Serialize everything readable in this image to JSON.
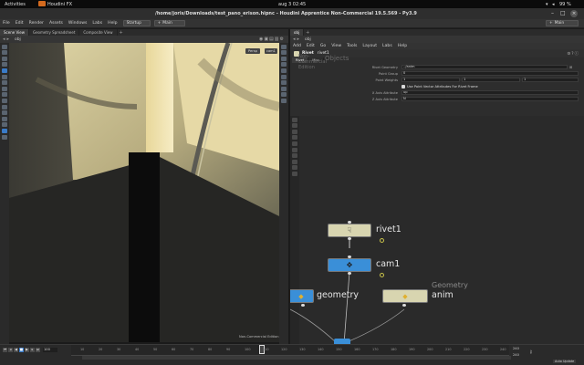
{
  "topbar": {
    "activities": "Activities",
    "app_name": "Houdini FX",
    "clock": "aug 3  02:45",
    "battery": "99 %"
  },
  "titlebar": {
    "title": "/home/joris/Downloads/test_pano_erison.hipnc - Houdini Apprentice Non-Commercial 19.5.569 - Py3.9"
  },
  "menubar": {
    "items": [
      "File",
      "Edit",
      "Render",
      "Assets",
      "Windows",
      "Labs",
      "Help"
    ],
    "desktop_selector": "Startup",
    "shelf_selector": "Main",
    "right_selector": "Main"
  },
  "left_pane": {
    "tabs": [
      "Scene View",
      "Geometry Spreadsheet",
      "Composite View"
    ],
    "path": "obj",
    "viewport_menus": [
      "Persp",
      "cam1"
    ],
    "watermark": "Non-Commercial Edition"
  },
  "right_pane": {
    "tabs": [
      "obj"
    ],
    "path": "obj",
    "menu_items": [
      "Add",
      "Edit",
      "Go",
      "View",
      "Tools",
      "Layout",
      "Labs",
      "Help"
    ],
    "node_type": "Rivet",
    "node_name": "rivet1",
    "param_tabs": [
      "Rivet",
      "Misc"
    ],
    "params": [
      {
        "label": "Rivet Geometry",
        "value": "../anim"
      },
      {
        "label": "Point Group",
        "value": "0"
      },
      {
        "label": "Point Weights",
        "values": [
          "1",
          "1",
          "1"
        ]
      },
      {
        "label": "",
        "value": "Use Point Vector Attributes For Rivet Frame"
      },
      {
        "label": "X Axis Attribute",
        "value": "up"
      },
      {
        "label": "Z Axis Attribute",
        "value": "N"
      }
    ],
    "net_watermark_1": "Non-Commercial Edition",
    "net_watermark_2": "Objects",
    "nodes": [
      {
        "name": "rivet1",
        "color": "#d8d5b0"
      },
      {
        "name": "cam1",
        "color": "#3a8fd8"
      },
      {
        "name": "geometry",
        "color": "#3a8fd8"
      },
      {
        "name": "anim",
        "color": "#d8d5b0",
        "context": "Geometry"
      }
    ]
  },
  "timeline": {
    "current_frame": "100",
    "ticks": [
      "10",
      "20",
      "30",
      "40",
      "50",
      "60",
      "70",
      "80",
      "90",
      "100",
      "110",
      "120",
      "130",
      "140",
      "150",
      "160",
      "170",
      "180",
      "190",
      "200",
      "210",
      "220",
      "230",
      "240"
    ],
    "end_frame_1": "240",
    "end_frame_2": "240",
    "auto_update": "Auto Update"
  }
}
